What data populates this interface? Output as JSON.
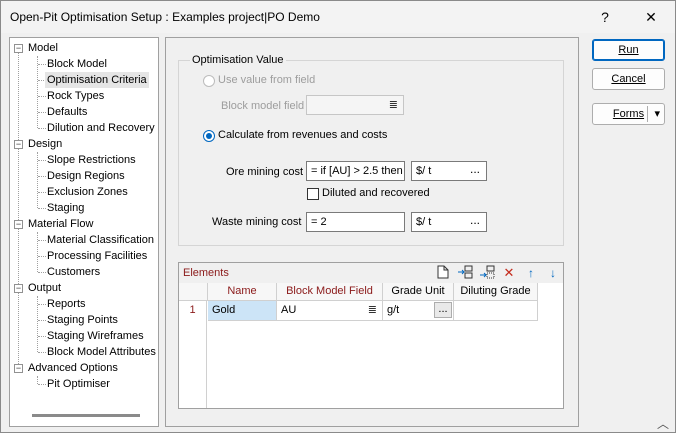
{
  "window": {
    "title": "Open-Pit Optimisation Setup : Examples project|PO Demo",
    "help_label": "?",
    "close_label": "✕"
  },
  "tree": {
    "items": [
      {
        "label": "Model",
        "level": 0
      },
      {
        "label": "Block Model",
        "level": 1
      },
      {
        "label": "Optimisation Criteria",
        "level": 1,
        "selected": true
      },
      {
        "label": "Rock Types",
        "level": 1
      },
      {
        "label": "Defaults",
        "level": 1
      },
      {
        "label": "Dilution and Recovery",
        "level": 1
      },
      {
        "label": "Design",
        "level": 0
      },
      {
        "label": "Slope Restrictions",
        "level": 1
      },
      {
        "label": "Design Regions",
        "level": 1
      },
      {
        "label": "Exclusion Zones",
        "level": 1
      },
      {
        "label": "Staging",
        "level": 1
      },
      {
        "label": "Material Flow",
        "level": 0
      },
      {
        "label": "Material Classification",
        "level": 1
      },
      {
        "label": "Processing Facilities",
        "level": 1
      },
      {
        "label": "Customers",
        "level": 1
      },
      {
        "label": "Output",
        "level": 0
      },
      {
        "label": "Reports",
        "level": 1
      },
      {
        "label": "Staging Points",
        "level": 1
      },
      {
        "label": "Staging Wireframes",
        "level": 1
      },
      {
        "label": "Block Model Attributes",
        "level": 1
      },
      {
        "label": "Advanced Options",
        "level": 0
      },
      {
        "label": "Pit Optimiser",
        "level": 1
      }
    ],
    "expander_symbol": "−"
  },
  "optimisation_value": {
    "group_title": "Optimisation Value",
    "use_value_label": "Use value from field",
    "block_model_field_label": "Block model field",
    "block_model_field_value": "",
    "calculate_label": "Calculate from revenues and costs",
    "ore_mining_cost_label": "Ore mining cost",
    "ore_mining_cost_value": "=   if [AU] > 2.5 then",
    "ore_unit_value": "$/   t",
    "diluted_label": "Diluted and recovered",
    "waste_mining_cost_label": "Waste mining cost",
    "waste_mining_cost_value": "=   2",
    "waste_unit_value": "$/   t",
    "ellipsis": "...",
    "menu_glyph": "≣"
  },
  "elements": {
    "title": "Elements",
    "columns": [
      "Name",
      "Block Model Field",
      "Grade Unit",
      "Diluting Grade"
    ],
    "rows": [
      {
        "num": "1",
        "name": "Gold",
        "field": "AU",
        "unit": "g/t",
        "diluting": ""
      }
    ],
    "icons": [
      "new-file-icon",
      "insert-row-icon",
      "append-row-icon",
      "delete-row-icon",
      "move-up-icon",
      "move-down-icon"
    ]
  },
  "buttons": {
    "run": "Run",
    "cancel": "Cancel",
    "forms": "Forms",
    "dropdown": "▾"
  },
  "colors": {
    "accent": "#0067c0",
    "required_label": "#8b1a1a",
    "selection": "#cce4f7"
  }
}
